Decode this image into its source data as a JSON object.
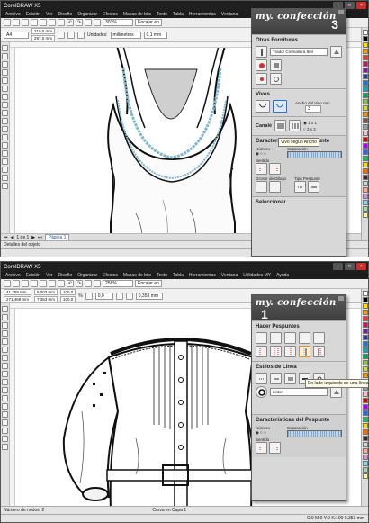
{
  "window1": {
    "title": "CorelDRAW X5",
    "menu": [
      "Archivo",
      "Edición",
      "Ver",
      "Diseño",
      "Organizar",
      "Efectos",
      "Mapas de bits",
      "Texto",
      "Tabla",
      "Herramientas",
      "Ventana"
    ],
    "zoom": "303%",
    "snap": "Encajar en",
    "page_width": "210,0 mm",
    "page_height": "297,0 mm",
    "paper": "A4",
    "units_label": "Unidades:",
    "units": "milímetros",
    "nudge": "0,1 mm",
    "page_indicator": "1 de 1",
    "page_tab": "Página 1",
    "status": "Detalles del objeto",
    "docker": {
      "brand": "my. confección",
      "number": "3",
      "otras_title": "Otras Fornituras",
      "fornitura_value": "Trador Cremallera 8ml",
      "vivos_title": "Vivos",
      "vivo_width_label": "Ancho del Vivo mm.",
      "vivo_width_value": "3",
      "canale_label": "Canalé",
      "tooltip": "Vivo según Ancho",
      "canale_1": "1 x 1",
      "canale_2": "2 x 2",
      "caract_title": "Características del Pespunte",
      "numero_label": "Número",
      "sep_label": "Separación",
      "sentido_label": "Sentido",
      "grosor_label": "Grosor de Dibujo",
      "tipo_label": "Tipo Pespunte",
      "seleccionar": "Seleccionar"
    },
    "palette": [
      "#ffffff",
      "#000000",
      "#ffe100",
      "#f4a300",
      "#e63b2e",
      "#c2185b",
      "#7b1fa2",
      "#303f9f",
      "#1976d2",
      "#00acc1",
      "#00a651",
      "#8bc34a",
      "#cddc39",
      "#ff9800",
      "#795548",
      "#9e9e9e",
      "#f8bbd0",
      "#d50000",
      "#aa00ff",
      "#2962ff",
      "#00c853",
      "#ffd600",
      "#ff6d00",
      "#3e2723",
      "#cfd8dc",
      "#ffab91",
      "#ce93d8",
      "#80deea",
      "#a5d6a7",
      "#fff59d"
    ]
  },
  "window2": {
    "title": "CorelDRAW X5",
    "menu": [
      "Archivo",
      "Edición",
      "Ver",
      "Diseño",
      "Organizar",
      "Efectos",
      "Mapas de bits",
      "Texto",
      "Tabla",
      "Herramientas",
      "Ventana",
      "Utilidades MY",
      "Ayuda"
    ],
    "x_value": "41,259 mm",
    "y_value": "271,469 mm",
    "w_value": "6,003 mm",
    "h_value": "7,353 mm",
    "scale_x": "100,0",
    "scale_y": "100,0",
    "scale_unit": "%",
    "angle": "0,0",
    "zoom": "256%",
    "snap": "Encajar en",
    "outline": "0,353 mm",
    "status_nodes": "Número de nodos: 2",
    "status_curve": "Curva en Capa 1",
    "status_color": "C:0 M:0 Y:0 K:100  0,353 mm",
    "docker": {
      "brand": "my. confección",
      "number": "1",
      "hacer_title": "Hacer Pespuntes",
      "tooltip": "En lado izquierdo de una línea",
      "estilos_title": "Estilos de Línea",
      "estilo_value": "Liston",
      "caract_title": "Características del Pespunte",
      "numero_label": "Número",
      "sep_label": "Separación",
      "sentido_label": "Sentido"
    },
    "palette": [
      "#ffffff",
      "#000000",
      "#ffe100",
      "#f4a300",
      "#e63b2e",
      "#c2185b",
      "#7b1fa2",
      "#303f9f",
      "#1976d2",
      "#00acc1",
      "#00a651",
      "#8bc34a",
      "#cddc39",
      "#ff9800",
      "#795548",
      "#9e9e9e",
      "#f8bbd0",
      "#d50000",
      "#aa00ff",
      "#2962ff",
      "#00c853",
      "#ffd600",
      "#ff6d00",
      "#3e2723",
      "#cfd8dc",
      "#ffab91",
      "#ce93d8",
      "#80deea",
      "#a5d6a7",
      "#fff59d"
    ]
  }
}
